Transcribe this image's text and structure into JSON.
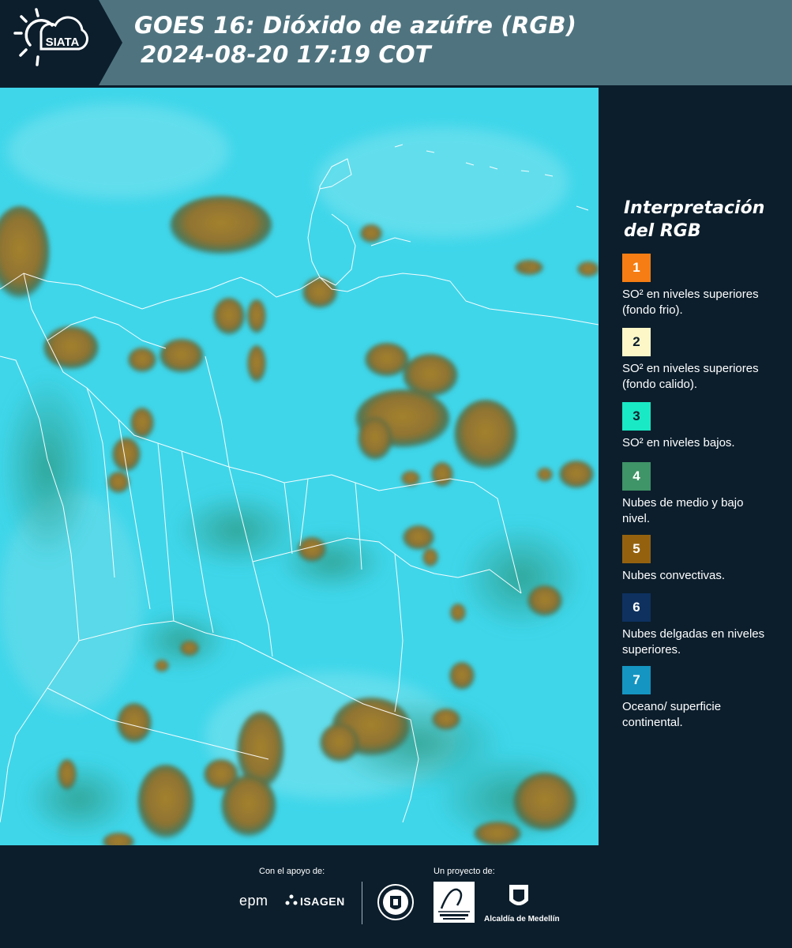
{
  "header": {
    "brand": "SIATA",
    "title_line1": "GOES 16: Dióxido de azúfre (RGB)",
    "title_line2": "2024-08-20 17:19 COT",
    "bg_color": "#4f7480"
  },
  "legend": {
    "title": "Interpretación del RGB",
    "items": [
      {
        "num": "1",
        "label": "SO² en niveles superiores (fondo frio).",
        "color": "#f57d13"
      },
      {
        "num": "2",
        "label": "SO² en niveles superiores (fondo calido).",
        "color": "#fdf7c8"
      },
      {
        "num": "3",
        "label": "SO² en niveles bajos.",
        "color": "#19e9c4"
      },
      {
        "num": "4",
        "label": "Nubes de medio y bajo nivel.",
        "color": "#3f9468"
      },
      {
        "num": "5",
        "label": "Nubes convectivas.",
        "color": "#94620f"
      },
      {
        "num": "6",
        "label": "Nubes delgadas en niveles superiores.",
        "color": "#0e315f"
      },
      {
        "num": "7",
        "label": "Oceano/ superficie continental.",
        "color": "#1595c1"
      }
    ]
  },
  "footer": {
    "support_label": "Con el apoyo de:",
    "project_label": "Un proyecto de:",
    "sponsor1": "epm",
    "sponsor2": "ISAGEN",
    "partner1": "Área Metropolitana Valle de Aburrá",
    "partner2": "Alcaldía de Medellín"
  },
  "map": {
    "sky_color": "#3fd6ea",
    "cloud_color": "#9a7a2e",
    "border_color": "#ffffff"
  }
}
